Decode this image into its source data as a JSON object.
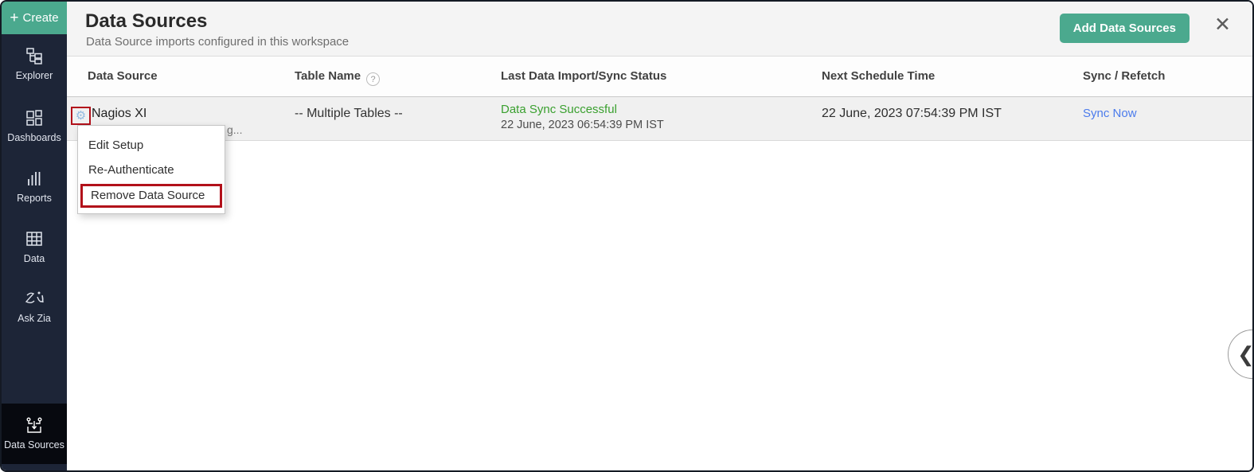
{
  "sidebar": {
    "create_label": "Create",
    "items": [
      {
        "label": "Explorer"
      },
      {
        "label": "Dashboards"
      },
      {
        "label": "Reports"
      },
      {
        "label": "Data"
      },
      {
        "label": "Ask Zia"
      },
      {
        "label": "Data Sources",
        "active": true
      }
    ]
  },
  "header": {
    "title": "Data Sources",
    "subtitle": "Data Source imports configured in this workspace",
    "add_button_label": "Add Data Sources",
    "close_icon": "✕"
  },
  "table": {
    "headers": {
      "data_source": "Data Source",
      "table_name": "Table Name",
      "table_name_help": "?",
      "last_status": "Last Data Import/Sync Status",
      "next_schedule": "Next Schedule Time",
      "sync_refetch": "Sync / Refetch"
    },
    "row": {
      "name": "Nagios XI",
      "truncated_fragment": "g...",
      "table_name": "-- Multiple Tables --",
      "status": "Data Sync Successful",
      "status_time": "22 June, 2023 06:54:39 PM IST",
      "next_schedule_time": "22 June, 2023 07:54:39 PM IST",
      "action": "Sync Now"
    }
  },
  "context_menu": {
    "items": [
      {
        "label": "Edit Setup"
      },
      {
        "label": "Re-Authenticate"
      },
      {
        "label": "Remove Data Source",
        "highlighted": true
      }
    ]
  },
  "collapse_button": {
    "icon": "❮"
  },
  "colors": {
    "accent_green": "#4BA98E",
    "sidebar_bg": "#1D2537",
    "sidebar_active_bg": "#07090F",
    "status_green": "#3AA02F",
    "link_blue": "#4B7BEC",
    "annotation_red": "#B2101A",
    "gear_blue": "#93BBE1"
  }
}
